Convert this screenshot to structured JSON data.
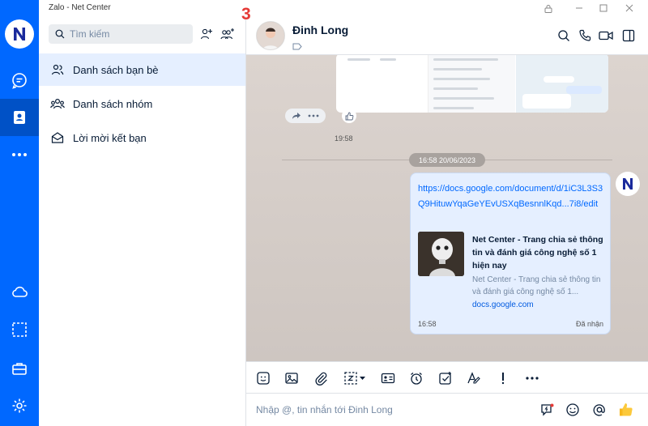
{
  "app": {
    "title": "Zalo - Net Center"
  },
  "rail": {
    "logo_letter": "N"
  },
  "sidebar": {
    "search_placeholder": "Tìm kiếm",
    "items": [
      {
        "label": "Danh sách bạn bè",
        "icon": "friends-icon",
        "active": true
      },
      {
        "label": "Danh sách nhóm",
        "icon": "group-icon",
        "active": false
      },
      {
        "label": "Lời mời kết bạn",
        "icon": "envelope-icon",
        "active": false
      }
    ]
  },
  "chat": {
    "contact_name": "Đinh Long",
    "annotation_number": "3",
    "prev_message_time": "19:58",
    "date_divider": "16:58 20/06/2023",
    "message": {
      "link": "https://docs.google.com/document/d/1iC3L3S3Q9HituwYqaGeYEvUSXqBesnnlKqd...7i8/edit",
      "preview_title": "Net Center - Trang chia sẻ thông tin và đánh giá công nghệ số 1 hiện nay",
      "preview_desc": "Net Center - Trang chia sẻ thông tin và đánh giá công nghệ số 1...",
      "preview_domain": "docs.google.com",
      "time": "16:58",
      "status": "Đã nhận"
    },
    "sender_avatar_letter": "N"
  },
  "composer": {
    "placeholder": "Nhập @, tin nhắn tới Đinh Long"
  },
  "colors": {
    "brand": "#0068ff",
    "active_item": "#e5efff",
    "annotation": "#e53935"
  }
}
